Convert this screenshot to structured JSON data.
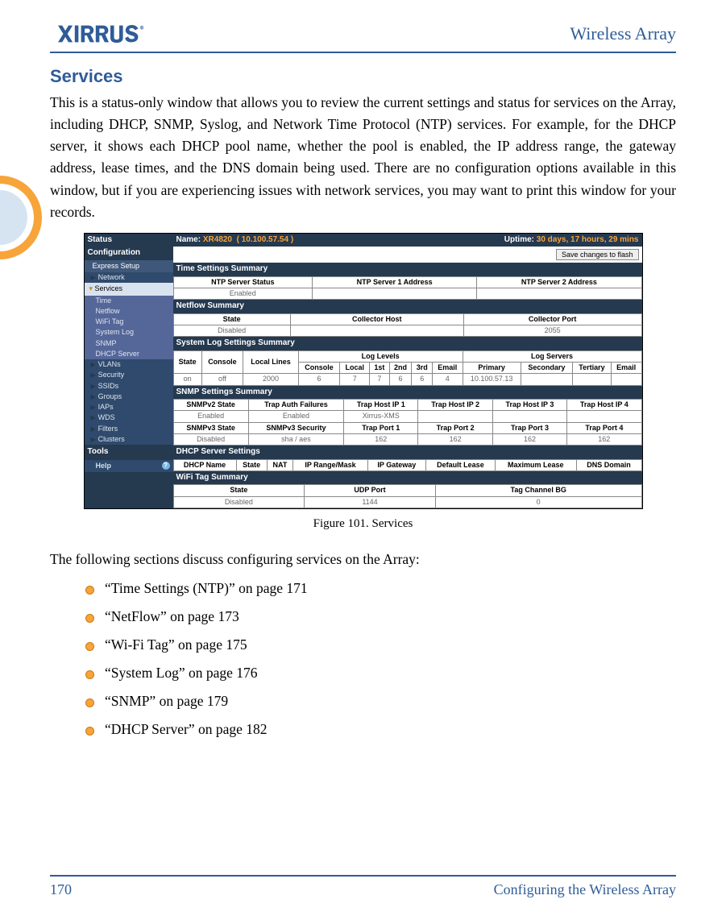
{
  "header": {
    "brand": "XIRRUS",
    "title": "Wireless Array"
  },
  "section_heading": "Services",
  "intro": "This is a status-only window that allows you to review the current settings and status for services on the Array, including DHCP, SNMP, Syslog, and Network Time Protocol (NTP) services. For example, for the DHCP server, it shows each DHCP pool name, whether the pool is enabled, the IP address range, the gateway address, lease times, and the DNS domain being used. There are no configuration options available in this window, but if you are experiencing issues with network services, you may want to print this window for your records.",
  "figure_caption": "Figure 101. Services",
  "after_fig": "The following sections discuss configuring services on the Array:",
  "list": [
    "“Time Settings (NTP)” on page 171",
    "“NetFlow” on page 173",
    "“Wi-Fi Tag” on page 175",
    "“System Log” on page 176",
    "“SNMP” on page 179",
    "“DHCP Server” on page 182"
  ],
  "footer": {
    "page": "170",
    "label": "Configuring the Wireless Array"
  },
  "ui": {
    "nav": {
      "status": "Status",
      "config": "Configuration",
      "express": "Express Setup",
      "network": "Network",
      "services": "Services",
      "subs": [
        "Time",
        "Netflow",
        "WiFi Tag",
        "System Log",
        "SNMP",
        "DHCP Server"
      ],
      "links": [
        "VLANs",
        "Security",
        "SSIDs",
        "Groups",
        "IAPs",
        "WDS",
        "Filters",
        "Clusters"
      ],
      "tools": "Tools",
      "help": "Help"
    },
    "top": {
      "name_lbl": "Name:",
      "name": "XR4820",
      "ip": "( 10.100.57.54 )",
      "uptime_lbl": "Uptime:",
      "uptime": "30 days, 17 hours, 29 mins"
    },
    "save_btn": "Save changes to flash",
    "time": {
      "bar": "Time Settings Summary",
      "h1": "NTP Server Status",
      "h2": "NTP Server 1 Address",
      "h3": "NTP Server 2 Address",
      "v1": "Enabled"
    },
    "netflow": {
      "bar": "Netflow Summary",
      "h1": "State",
      "h2": "Collector Host",
      "h3": "Collector Port",
      "v1": "Disabled",
      "v3": "2055"
    },
    "syslog": {
      "bar": "System Log Settings Summary",
      "grp1": "Log Levels",
      "grp2": "Log Servers",
      "h": [
        "State",
        "Console",
        "Local Lines",
        "Console",
        "Local",
        "1st",
        "2nd",
        "3rd",
        "Email",
        "Primary",
        "Secondary",
        "Tertiary",
        "Email"
      ],
      "v": [
        "on",
        "off",
        "2000",
        "6",
        "7",
        "7",
        "6",
        "6",
        "4",
        "10.100.57.13",
        "",
        "",
        ""
      ]
    },
    "snmp": {
      "bar": "SNMP Settings Summary",
      "r1h": [
        "SNMPv2 State",
        "Trap Auth Failures",
        "Trap Host IP 1",
        "Trap Host IP 2",
        "Trap Host IP 3",
        "Trap Host IP 4"
      ],
      "r1v": [
        "Enabled",
        "Enabled",
        "Xirrus-XMS",
        "",
        "",
        ""
      ],
      "r2h": [
        "SNMPv3 State",
        "SNMPv3 Security",
        "Trap Port 1",
        "Trap Port 2",
        "Trap Port 3",
        "Trap Port 4"
      ],
      "r2v": [
        "Disabled",
        "sha / aes",
        "162",
        "162",
        "162",
        "162"
      ]
    },
    "dhcp": {
      "bar": "DHCP Server Settings",
      "h": [
        "DHCP Name",
        "State",
        "NAT",
        "IP Range/Mask",
        "IP Gateway",
        "Default Lease",
        "Maximum Lease",
        "DNS Domain"
      ]
    },
    "wifi": {
      "bar": "WiFi Tag Summary",
      "h": [
        "State",
        "UDP Port",
        "Tag Channel BG"
      ],
      "v": [
        "Disabled",
        "1144",
        "0"
      ]
    }
  }
}
